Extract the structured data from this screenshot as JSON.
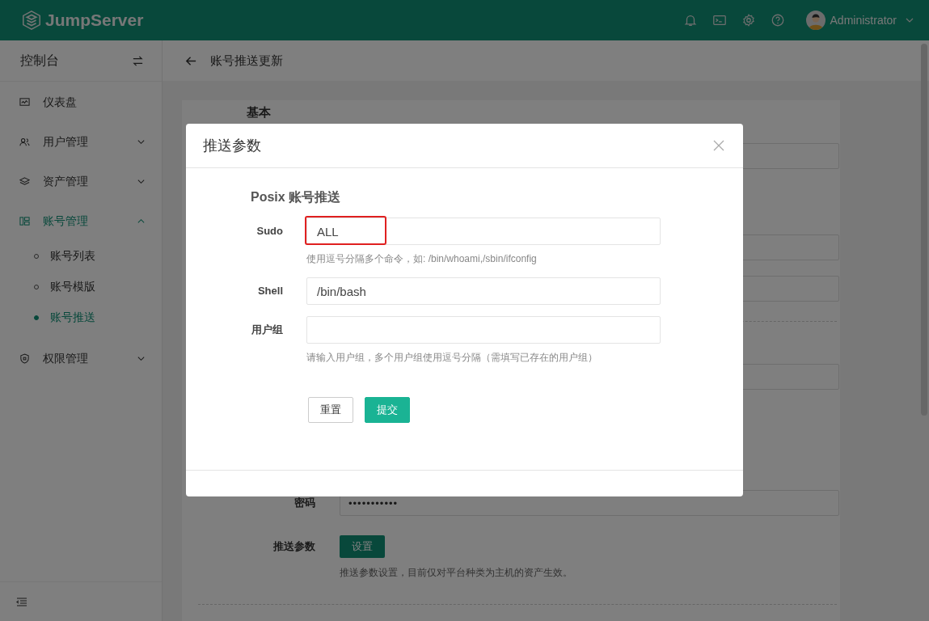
{
  "header": {
    "logo": "JumpServer",
    "user": "Administrator"
  },
  "sidebar": {
    "title": "控制台",
    "items": [
      {
        "label": "仪表盘",
        "active": false
      },
      {
        "label": "用户管理",
        "expanded": false,
        "active": false
      },
      {
        "label": "资产管理",
        "expanded": false,
        "active": false
      },
      {
        "label": "账号管理",
        "expanded": true,
        "active": true,
        "children": [
          {
            "label": "账号列表",
            "selected": false
          },
          {
            "label": "账号模版",
            "selected": false
          },
          {
            "label": "账号推送",
            "selected": true
          }
        ]
      },
      {
        "label": "权限管理",
        "expanded": false,
        "active": false
      }
    ]
  },
  "page": {
    "title": "账号推送更新",
    "section_title": "基本",
    "password_label": "密码",
    "password_value": "•••••••••••",
    "push_label": "推送参数",
    "push_button": "设置",
    "push_hint": "推送参数设置，目前仅对平台种类为主机的资产生效。"
  },
  "dialog": {
    "title": "推送参数",
    "section_title": "Posix 账号推送",
    "fields": [
      {
        "label": "Sudo",
        "value": "ALL",
        "hint": "使用逗号分隔多个命令，如: /bin/whoami,/sbin/ifconfig",
        "highlighted": true
      },
      {
        "label": "Shell",
        "value": "/bin/bash",
        "highlighted": false
      },
      {
        "label": "用户组",
        "hint": "请输入用户组，多个用户组使用逗号分隔（需填写已存在的用户组）",
        "highlighted": false
      }
    ],
    "buttons": [
      {
        "label": "重置",
        "kind": "default"
      },
      {
        "label": "提交",
        "kind": "primary"
      }
    ]
  }
}
